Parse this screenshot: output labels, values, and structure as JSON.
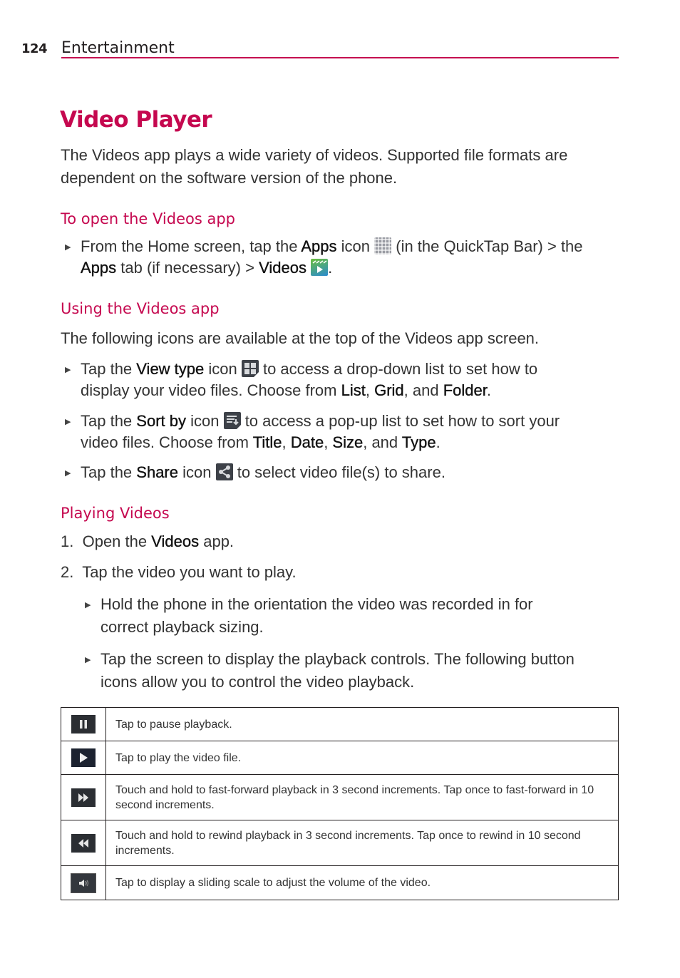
{
  "header": {
    "page_number": "124",
    "section": "Entertainment"
  },
  "title": "Video Player",
  "intro": "The Videos app plays a wide variety of videos. Supported file formats are dependent on the software version of the phone.",
  "open_section": {
    "heading": "To open the Videos app",
    "bullet": {
      "t1": "From the Home screen, tap the ",
      "b1": "Apps",
      "t2": " icon ",
      "icon1": "apps-grid-icon",
      "t3": " (in the QuickTap Bar) > the",
      "b2": "Apps",
      "t4": " tab (if necessary) > ",
      "b3": "Videos",
      "icon2": "videos-app-icon",
      "t5": "."
    }
  },
  "using_section": {
    "heading": "Using the Videos app",
    "intro": "The following icons are available at the top of the Videos app screen.",
    "bullets": [
      {
        "t1": "Tap the ",
        "b1": "View type",
        "t2": " icon ",
        "icon": "view-type-icon",
        "t3": " to access a drop-down list to set how to",
        "t4": "display your video files. Choose from ",
        "o1": "List",
        "s1": ", ",
        "o2": "Grid",
        "s2": ", and ",
        "o3": "Folder",
        "end": "."
      },
      {
        "t1": "Tap the ",
        "b1": "Sort by",
        "t2": " icon ",
        "icon": "sort-by-icon",
        "t3": " to access a pop-up list to set how to sort your",
        "t4": "video files. Choose from ",
        "o1": "Title",
        "s1": ", ",
        "o2": "Date",
        "s2": ", ",
        "o3": "Size",
        "s3": ", and ",
        "o4": "Type",
        "end": "."
      },
      {
        "t1": "Tap the ",
        "b1": "Share",
        "t2": " icon ",
        "icon": "share-icon",
        "t3": " to select video file(s) to share."
      }
    ]
  },
  "playing_section": {
    "heading": "Playing Videos",
    "steps": [
      {
        "num": "1.",
        "t1": "Open the ",
        "b1": "Videos",
        "t2": " app."
      },
      {
        "num": "2.",
        "t1": "Tap the video you want to play."
      }
    ],
    "sub_bullets": [
      {
        "line1": "Hold the phone in the orientation the video was recorded in for",
        "line2": "correct playback sizing."
      },
      {
        "line1": "Tap the screen to display the playback controls. The following button",
        "line2": "icons allow you to control the video playback."
      }
    ]
  },
  "controls_table": [
    {
      "icon": "pause-icon",
      "text": "Tap to pause playback."
    },
    {
      "icon": "play-icon",
      "text": "Tap to play the video file."
    },
    {
      "icon": "fast-forward-icon",
      "text": "Touch and hold to fast-forward playback in 3 second increments. Tap once to fast-forward in 10 second increments."
    },
    {
      "icon": "rewind-icon",
      "text": "Touch and hold to rewind playback in 3 second increments. Tap once to rewind in 10 second increments."
    },
    {
      "icon": "volume-icon",
      "text": "Tap to display a sliding scale to adjust the volume of the video."
    }
  ],
  "colors": {
    "accent": "#c5084f",
    "text": "#333333",
    "icon_bg": "#2b2e33"
  }
}
